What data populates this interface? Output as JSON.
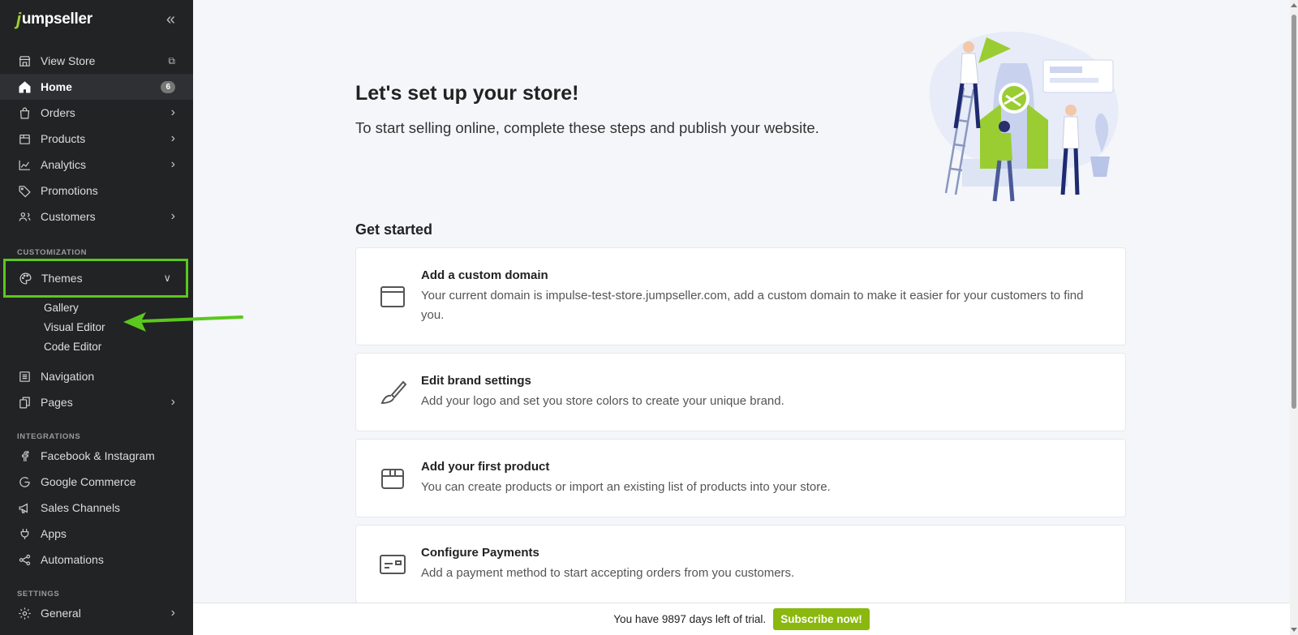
{
  "brand": {
    "logo_letter": "j",
    "logo_text": "umpseller",
    "accent": "#5ac81d"
  },
  "sidebar": {
    "collapse_icon": "«",
    "items_top": [
      {
        "label": "View Store",
        "icon": "store-icon"
      },
      {
        "label": "Home",
        "icon": "home-icon",
        "badge": "6",
        "active": true
      },
      {
        "label": "Orders",
        "icon": "orders-icon"
      },
      {
        "label": "Products",
        "icon": "products-icon"
      },
      {
        "label": "Analytics",
        "icon": "analytics-icon"
      },
      {
        "label": "Promotions",
        "icon": "tag-icon"
      },
      {
        "label": "Customers",
        "icon": "users-icon"
      }
    ],
    "customization_label": "CUSTOMIZATION",
    "themes": {
      "label": "Themes",
      "icon": "palette-icon",
      "sub": [
        "Gallery",
        "Visual Editor",
        "Code Editor"
      ]
    },
    "items_custom": [
      {
        "label": "Navigation",
        "icon": "list-icon"
      },
      {
        "label": "Pages",
        "icon": "pages-icon"
      }
    ],
    "integrations_label": "INTEGRATIONS",
    "items_integrations": [
      {
        "label": "Facebook & Instagram",
        "icon": "facebook-icon"
      },
      {
        "label": "Google Commerce",
        "icon": "google-icon"
      },
      {
        "label": "Sales Channels",
        "icon": "megaphone-icon"
      },
      {
        "label": "Apps",
        "icon": "plug-icon"
      },
      {
        "label": "Automations",
        "icon": "share-icon"
      }
    ],
    "settings_label": "SETTINGS",
    "items_settings": [
      {
        "label": "General",
        "icon": "gear-icon"
      }
    ]
  },
  "main": {
    "title": "Let's set up your store!",
    "subtitle": "To start selling online, complete these steps and publish your website.",
    "get_started": "Get started",
    "cards": [
      {
        "title": "Add a custom domain",
        "desc": "Your current domain is impulse-test-store.jumpseller.com, add a custom domain to make it easier for your customers to find you.",
        "icon": "browser-window-icon"
      },
      {
        "title": "Edit brand settings",
        "desc": "Add your logo and set you store colors to create your unique brand.",
        "icon": "paintbrush-icon"
      },
      {
        "title": "Add your first product",
        "desc": "You can create products or import an existing list of products into your store.",
        "icon": "box-icon"
      },
      {
        "title": "Configure Payments",
        "desc": "Add a payment method to start accepting orders from you customers.",
        "icon": "credit-card-icon"
      }
    ]
  },
  "trial": {
    "text": "You have 9897 days left of trial.",
    "button": "Subscribe now!"
  }
}
